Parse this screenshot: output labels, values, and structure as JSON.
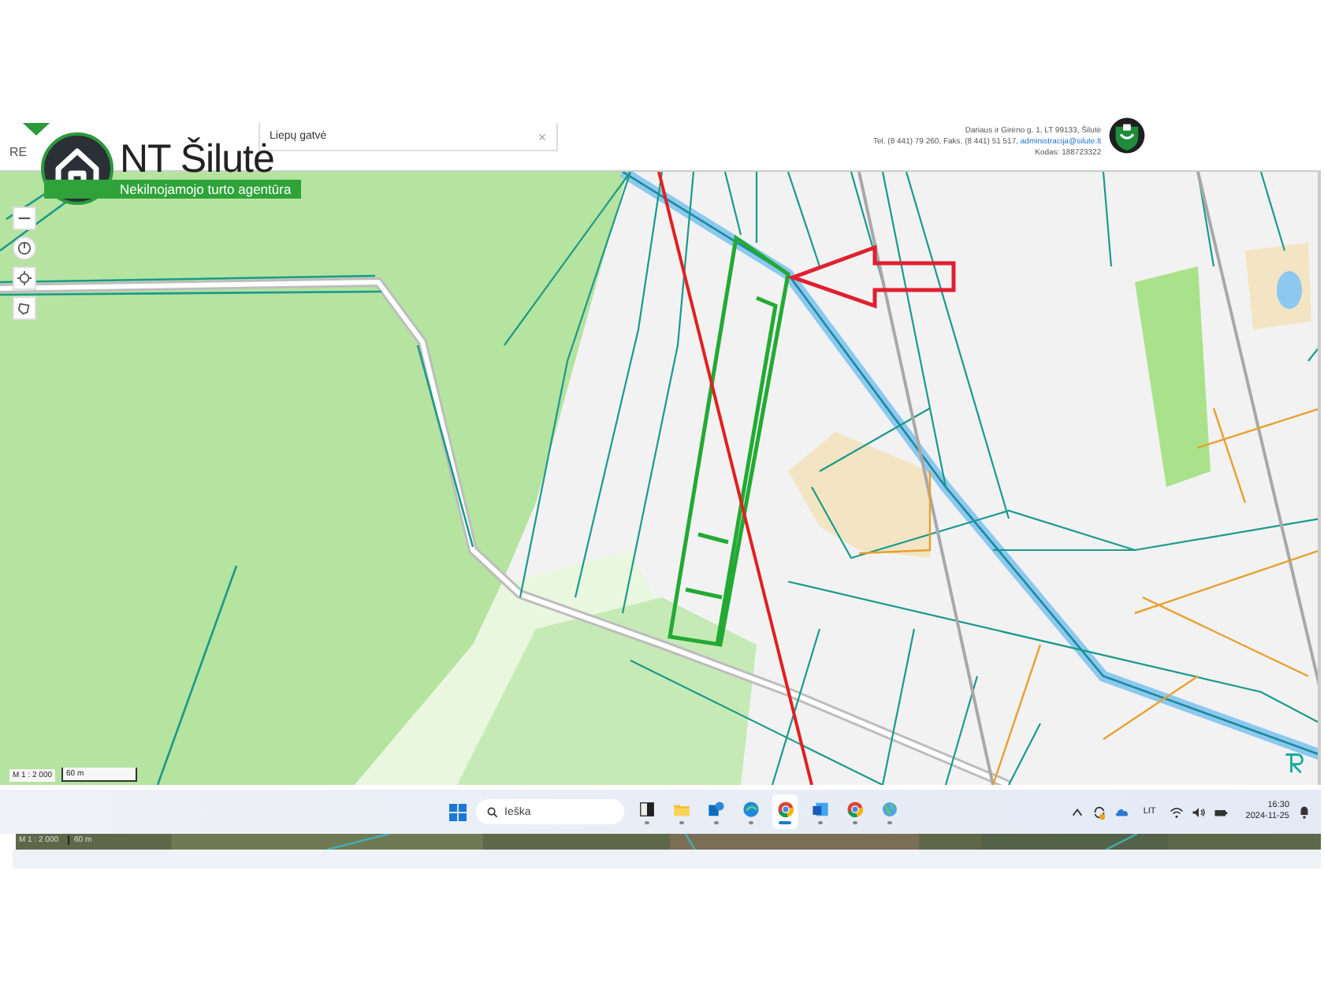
{
  "header": {
    "app_label": "RE",
    "search": {
      "value": "Liepų gatvė"
    },
    "address_lines": [
      "Dariaus ir Girėno g. 1, LT 99133, Šilutė",
      "Tel. (8 441) 79 260, Faks. (8 441) 51 517, administracija@silute.lt",
      "Kodas: 188723322"
    ]
  },
  "brand": {
    "name": "NT Šilutė",
    "tagline": "Nekilnojamojo turto agentūra"
  },
  "map": {
    "scale_label": "M 1 : 2 000",
    "scale_bar": "60 m"
  },
  "taskbar": {
    "search": {
      "placeholder": "Ieška"
    },
    "apps": [
      {
        "kind": "window",
        "selected": false
      },
      {
        "kind": "folder",
        "selected": false
      },
      {
        "kind": "mail",
        "selected": false
      },
      {
        "kind": "edge",
        "selected": false
      },
      {
        "kind": "chrome",
        "selected": true
      },
      {
        "kind": "word",
        "selected": false
      },
      {
        "kind": "chrome",
        "selected": false
      },
      {
        "kind": "globe",
        "selected": false
      }
    ],
    "language": "LIT",
    "time": "16:30",
    "date": "2024-11-25"
  },
  "background_strip": {
    "scale_label": "M 1 : 2 000",
    "scale_bar": "60 m"
  }
}
